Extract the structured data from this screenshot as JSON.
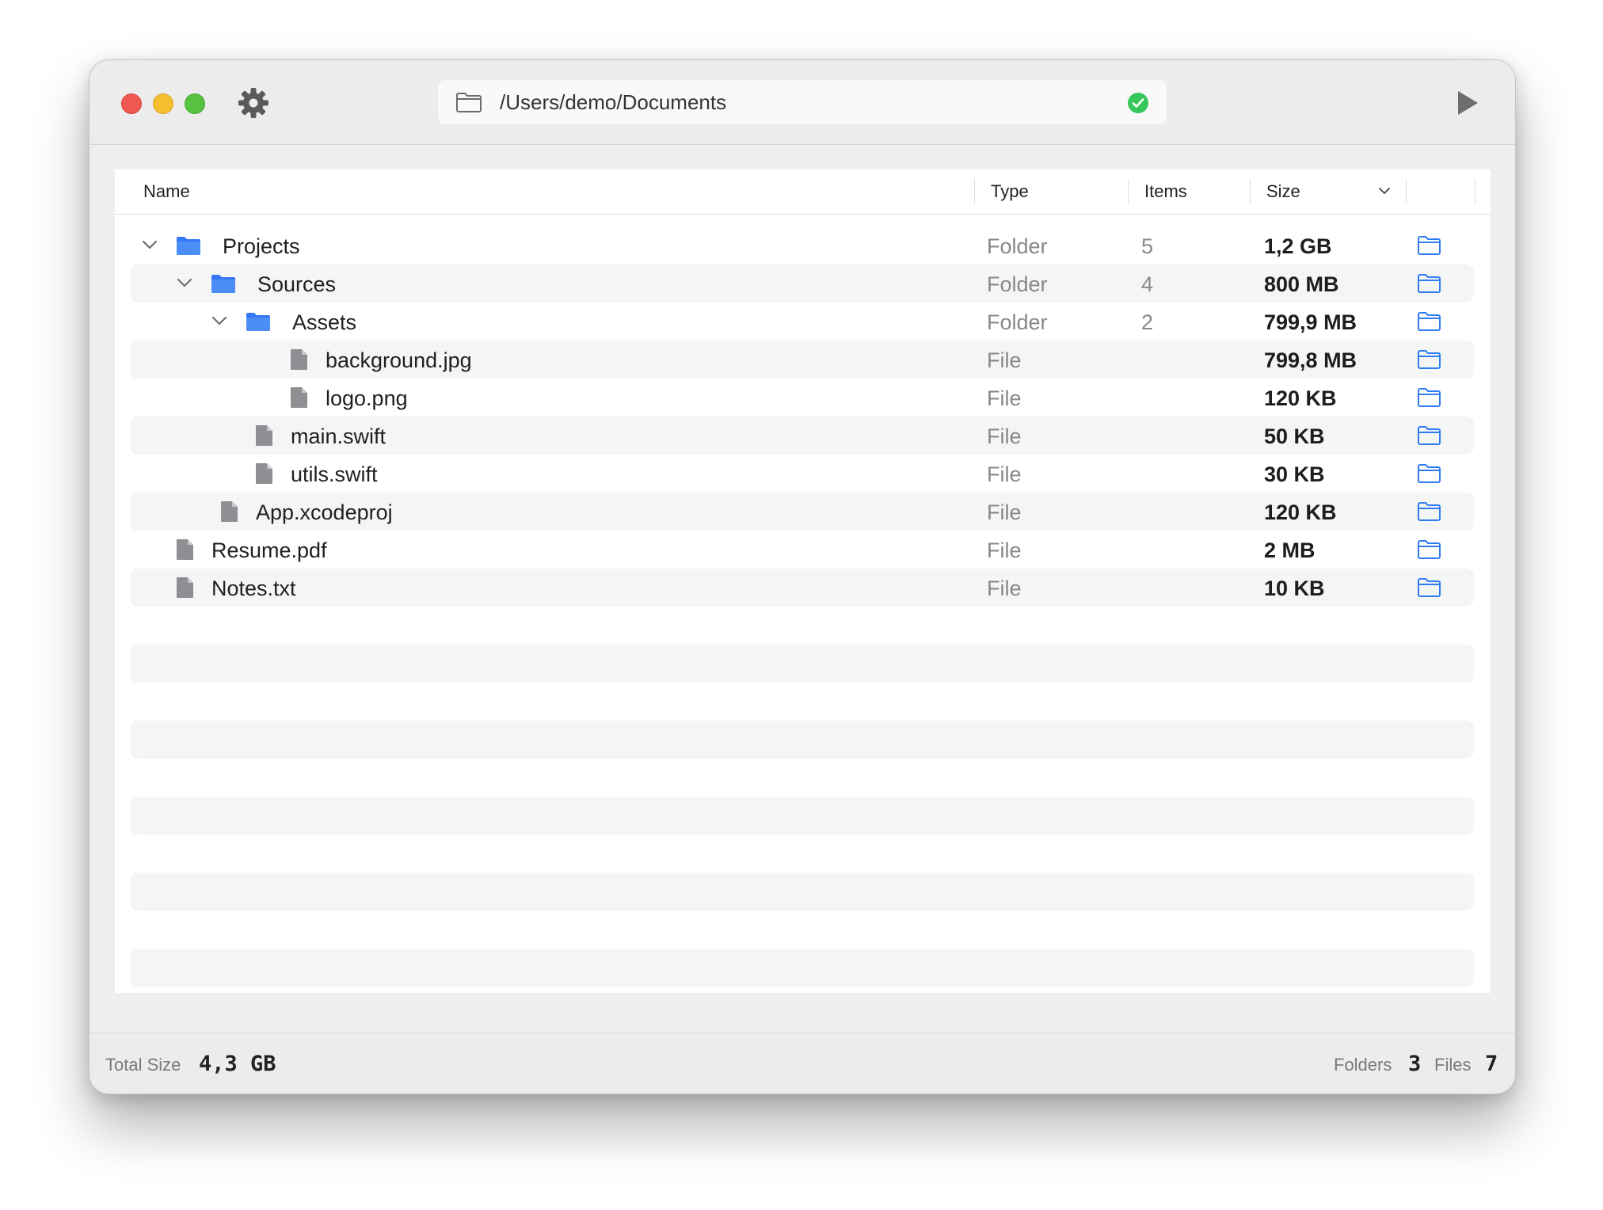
{
  "toolbar": {
    "path": "/Users/demo/Documents",
    "settings_icon": "gear-icon",
    "run_icon": "play-icon",
    "status_icon": "checkmark-circle-icon"
  },
  "columns": {
    "name": "Name",
    "type": "Type",
    "items": "Items",
    "size": "Size"
  },
  "rows": [
    {
      "name": "Projects",
      "type": "Folder",
      "items": "5",
      "size": "1,2 GB",
      "kind": "folder",
      "depth": 0,
      "expanded": true
    },
    {
      "name": "Sources",
      "type": "Folder",
      "items": "4",
      "size": "800 MB",
      "kind": "folder",
      "depth": 1,
      "expanded": true
    },
    {
      "name": "Assets",
      "type": "Folder",
      "items": "2",
      "size": "799,9 MB",
      "kind": "folder",
      "depth": 2,
      "expanded": true
    },
    {
      "name": "background.jpg",
      "type": "File",
      "items": "",
      "size": "799,8 MB",
      "kind": "file",
      "depth": 3
    },
    {
      "name": "logo.png",
      "type": "File",
      "items": "",
      "size": "120 KB",
      "kind": "file",
      "depth": 3
    },
    {
      "name": "main.swift",
      "type": "File",
      "items": "",
      "size": "50 KB",
      "kind": "file",
      "depth": 2
    },
    {
      "name": "utils.swift",
      "type": "File",
      "items": "",
      "size": "30 KB",
      "kind": "file",
      "depth": 2
    },
    {
      "name": "App.xcodeproj",
      "type": "File",
      "items": "",
      "size": "120 KB",
      "kind": "file",
      "depth": 1
    },
    {
      "name": "Resume.pdf",
      "type": "File",
      "items": "",
      "size": "2 MB",
      "kind": "file",
      "depth": 0
    },
    {
      "name": "Notes.txt",
      "type": "File",
      "items": "",
      "size": "10 KB",
      "kind": "file",
      "depth": 0
    }
  ],
  "status": {
    "total_size_label": "Total Size",
    "total_size_value": "4,3 GB",
    "folders_label": "Folders",
    "folders_value": "3",
    "files_label": "Files",
    "files_value": "7"
  },
  "colors": {
    "accent": "#2f7cf6",
    "folder_icon": "#3478f6",
    "file_icon": "#8e8e93",
    "check_green": "#34c759"
  }
}
